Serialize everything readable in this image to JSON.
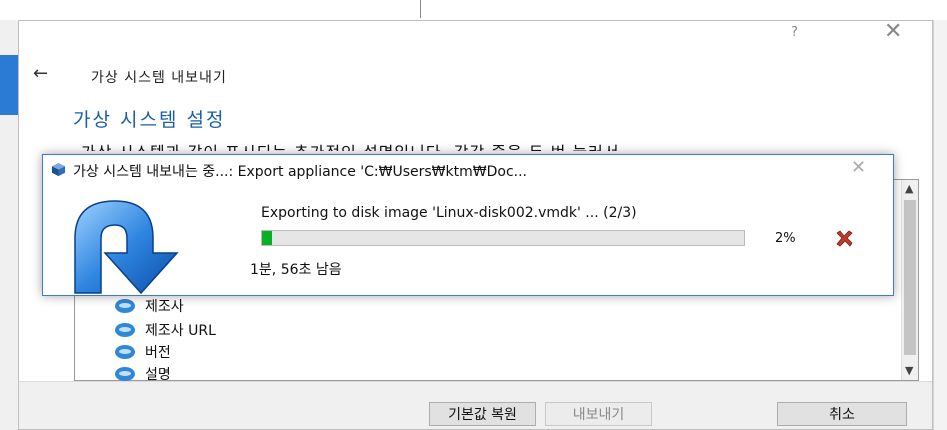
{
  "wizard": {
    "help_label": "?",
    "close_label": "✕",
    "back_label": "←",
    "title": "가상 시스템 내보내기",
    "heading": "가상 시스템 설정",
    "description": "가상 시스템과 같이 표시되는 추가적인 설명입니다. 각각 줄을 두 번 눌러서",
    "list_items": [
      {
        "label": "제조사",
        "icon": "speech-bubble-icon"
      },
      {
        "label": "제조사 URL",
        "icon": "speech-bubble-icon"
      },
      {
        "label": "버전",
        "icon": "speech-bubble-icon"
      },
      {
        "label": "설명",
        "icon": "speech-bubble-icon"
      }
    ],
    "buttons": {
      "restore_defaults": "기본값 복원",
      "export": "내보내기",
      "cancel": "취소"
    }
  },
  "progress_dialog": {
    "title": "가상 시스템 내보내는 중...: Export appliance 'C:₩Users₩ktm₩Doc...",
    "close_label": "✕",
    "operation": "Exporting to disk image 'Linux-disk002.vmdk' ... (2/3)",
    "percent_label": "2%",
    "progress_fraction": 0.02,
    "time_remaining": "1분, 56초 남음",
    "fill_color": "#06b025"
  },
  "colors": {
    "accent": "#2b7bd5",
    "heading": "#1b5ea8"
  }
}
